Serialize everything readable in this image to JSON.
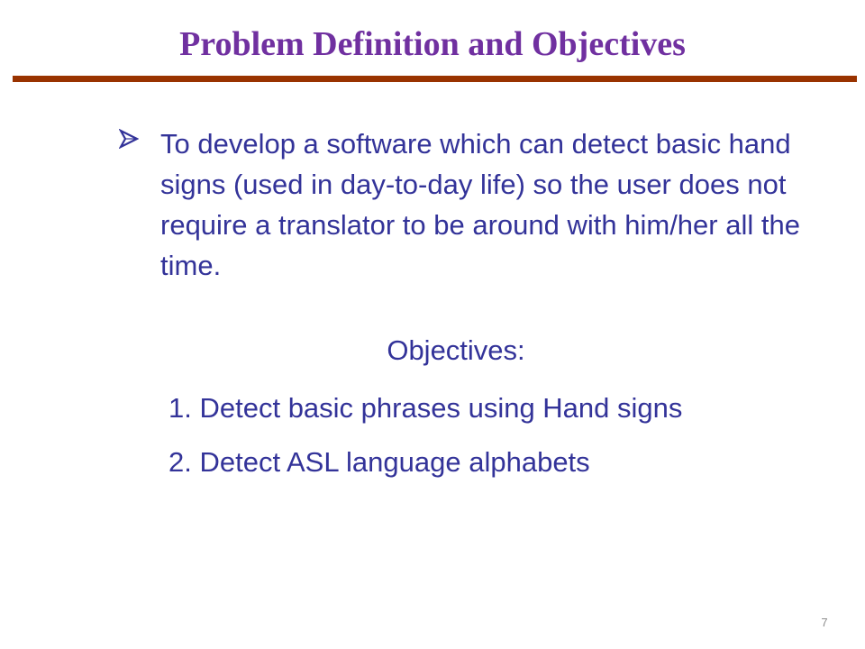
{
  "slide": {
    "title": "Problem Definition and Objectives",
    "bullet_icon": "arrowhead-bullet-icon",
    "bullet_text": "To develop a software which can detect basic hand signs (used in day-to-day life) so the user does not require a translator to be around with him/her all the time.",
    "objectives_heading": "Objectives:",
    "objectives": [
      {
        "number": "1.",
        "text": "Detect basic phrases using Hand signs"
      },
      {
        "number": "2.",
        "text": "Detect ASL language alphabets"
      }
    ],
    "page_number": "7"
  },
  "colors": {
    "title": "#7030A0",
    "rule": "#993300",
    "body_text": "#333399",
    "page_number": "#8c8c8c"
  }
}
